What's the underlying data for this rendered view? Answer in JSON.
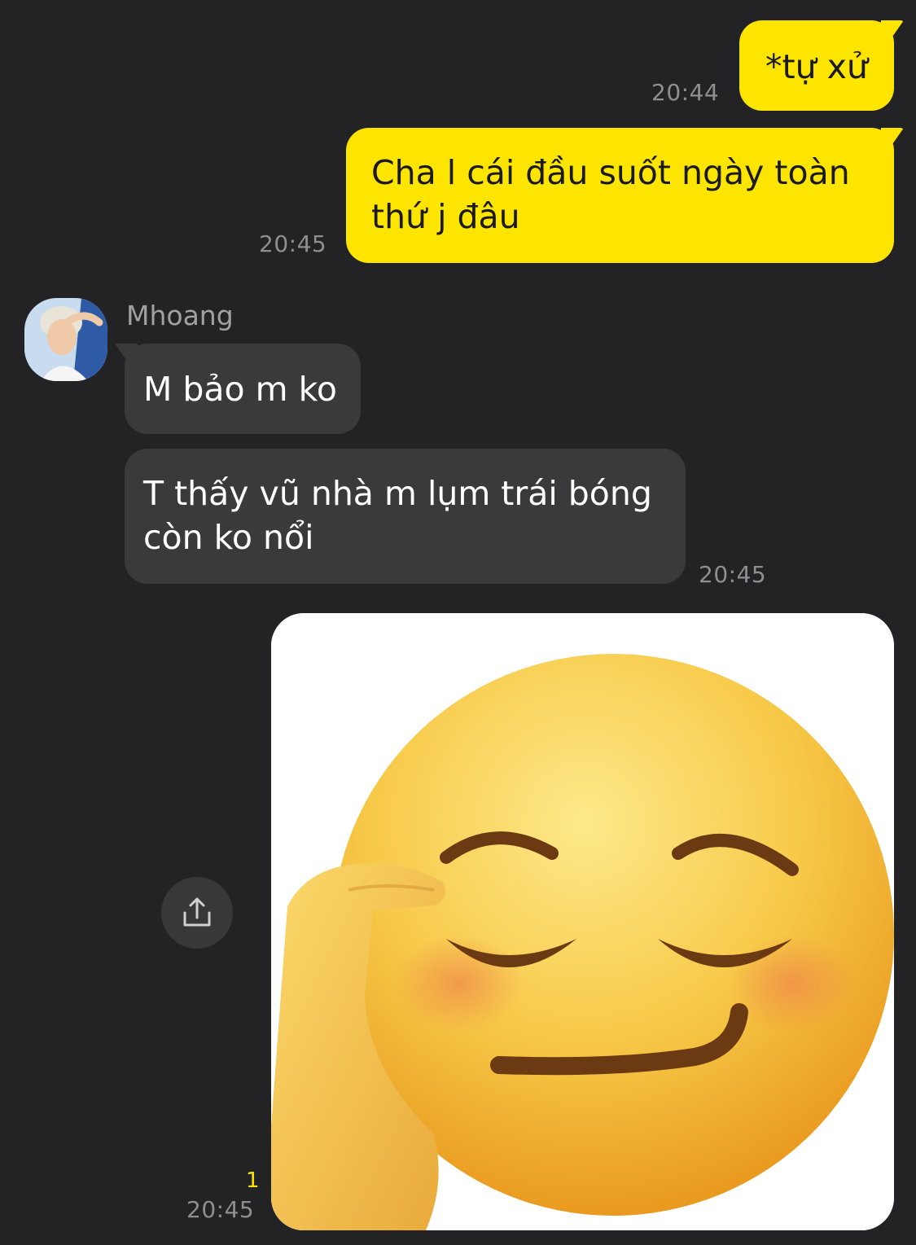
{
  "messages": [
    {
      "direction": "out",
      "text": "*tự xử",
      "time": "20:44"
    },
    {
      "direction": "out",
      "text": "Cha l cái đầu suốt ngày toàn thứ j đâu",
      "time": "20:45"
    },
    {
      "direction": "in",
      "sender": "Mhoang",
      "text": "M bảo m ko"
    },
    {
      "direction": "in",
      "text": "T thấy vũ nhà m lụm trái bóng còn ko nổi",
      "time": "20:45"
    },
    {
      "direction": "out",
      "type": "image",
      "image_desc": "saluting-smirk-emoji",
      "time": "20:45",
      "unread_count": "1"
    }
  ],
  "icons": {
    "share": "share-upload-icon",
    "avatar": "contact-avatar"
  },
  "colors": {
    "background": "#232325",
    "outgoing_bubble": "#fee500",
    "incoming_bubble": "#3a3a3c",
    "timestamp": "#8e8e93",
    "unread": "#fee500"
  }
}
